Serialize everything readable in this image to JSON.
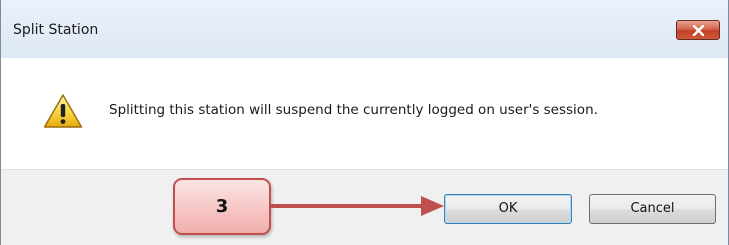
{
  "dialog": {
    "title": "Split Station",
    "message": "Splitting this station will suspend the currently logged on user's session.",
    "icon": "warning-icon"
  },
  "buttons": {
    "ok_label": "OK",
    "cancel_label": "Cancel",
    "close_icon": "close-icon"
  },
  "annotation": {
    "step_label": "3",
    "callout_color": "#c0504d",
    "arrow_color": "#c0504d"
  }
}
